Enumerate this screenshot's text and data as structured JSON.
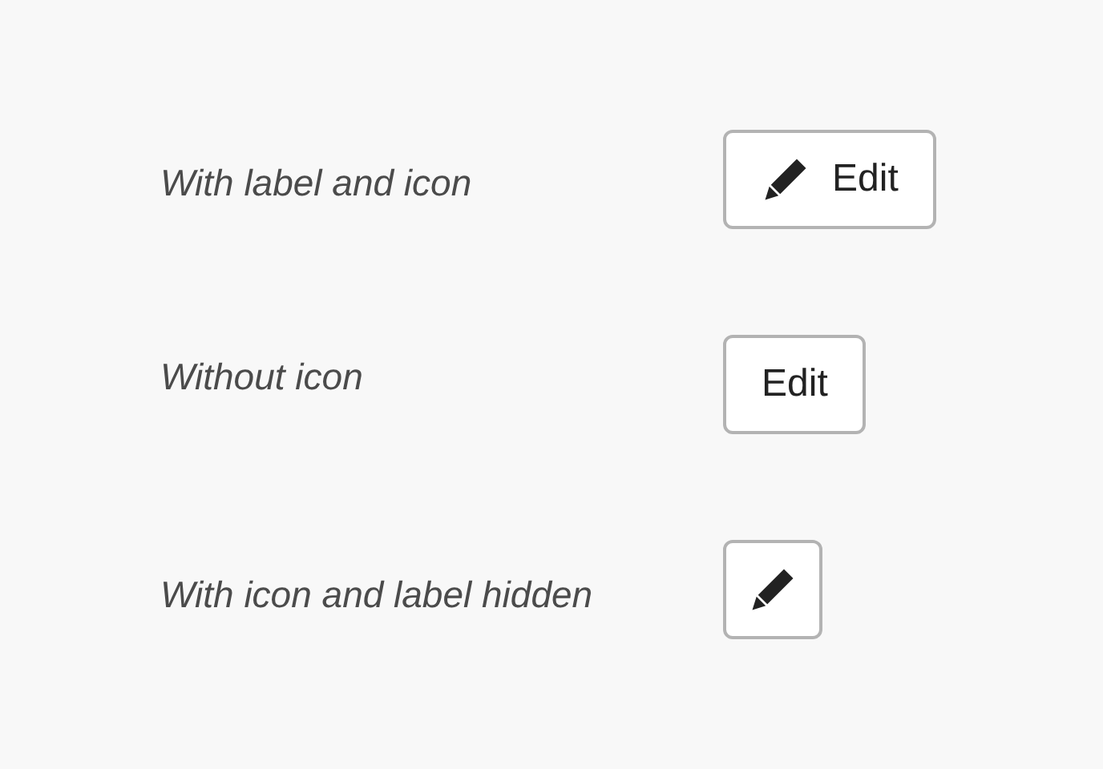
{
  "examples": [
    {
      "label": "With label and icon",
      "button": {
        "kind": "icon_label",
        "text": "Edit"
      }
    },
    {
      "label": "Without icon",
      "button": {
        "kind": "label",
        "text": "Edit"
      }
    },
    {
      "label": "With icon and label hidden",
      "button": {
        "kind": "icon"
      }
    }
  ]
}
